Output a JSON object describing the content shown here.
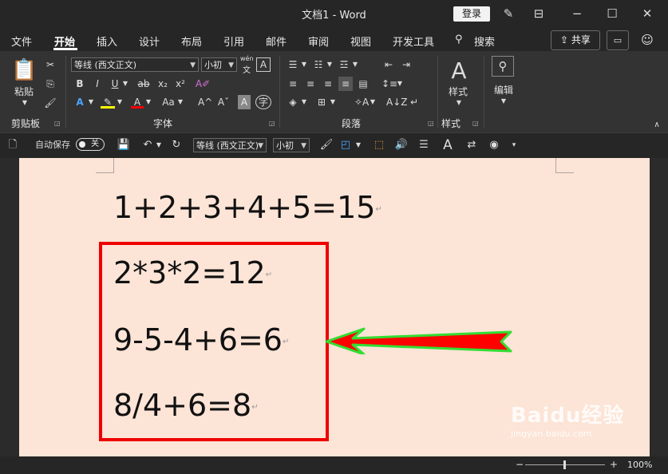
{
  "window": {
    "title": "文档1  -  Word",
    "login_label": "登录"
  },
  "menu": {
    "items": [
      "文件",
      "开始",
      "插入",
      "设计",
      "布局",
      "引用",
      "邮件",
      "审阅",
      "视图",
      "开发工具"
    ],
    "search_label": "搜索",
    "share_label": "共享"
  },
  "ribbon": {
    "clipboard": {
      "paste_label": "粘贴",
      "group_label": "剪贴板"
    },
    "font": {
      "font_name": "等线 (西文正文)",
      "font_size": "小初",
      "group_label": "字体",
      "phonetic_top": "wén",
      "phonetic_bottom": "文",
      "char_box": "A"
    },
    "paragraph": {
      "group_label": "段落"
    },
    "styles": {
      "label": "样式",
      "group_label": "样式"
    },
    "editing": {
      "label": "编辑"
    }
  },
  "qat": {
    "autosave_label": "自动保存",
    "autosave_state": "关",
    "font_name": "等线 (西文正文)",
    "font_size": "小初"
  },
  "document": {
    "lines": [
      "1+2+3+4+5=15",
      "2*3*2=12",
      "9-5-4+6=6",
      "8/4+6=8"
    ],
    "paragraph_mark": "↵"
  },
  "status": {
    "zoom": "100%",
    "zoom_minus": "−",
    "zoom_plus": "+"
  },
  "watermark": {
    "brand": "Baidu经验",
    "url": "jingyan.baidu.com"
  },
  "colors": {
    "page_background": "#fce4d6",
    "highlight_box": "#ee0000",
    "arrow_fill": "#ff0000",
    "arrow_outline": "#33dd33"
  }
}
